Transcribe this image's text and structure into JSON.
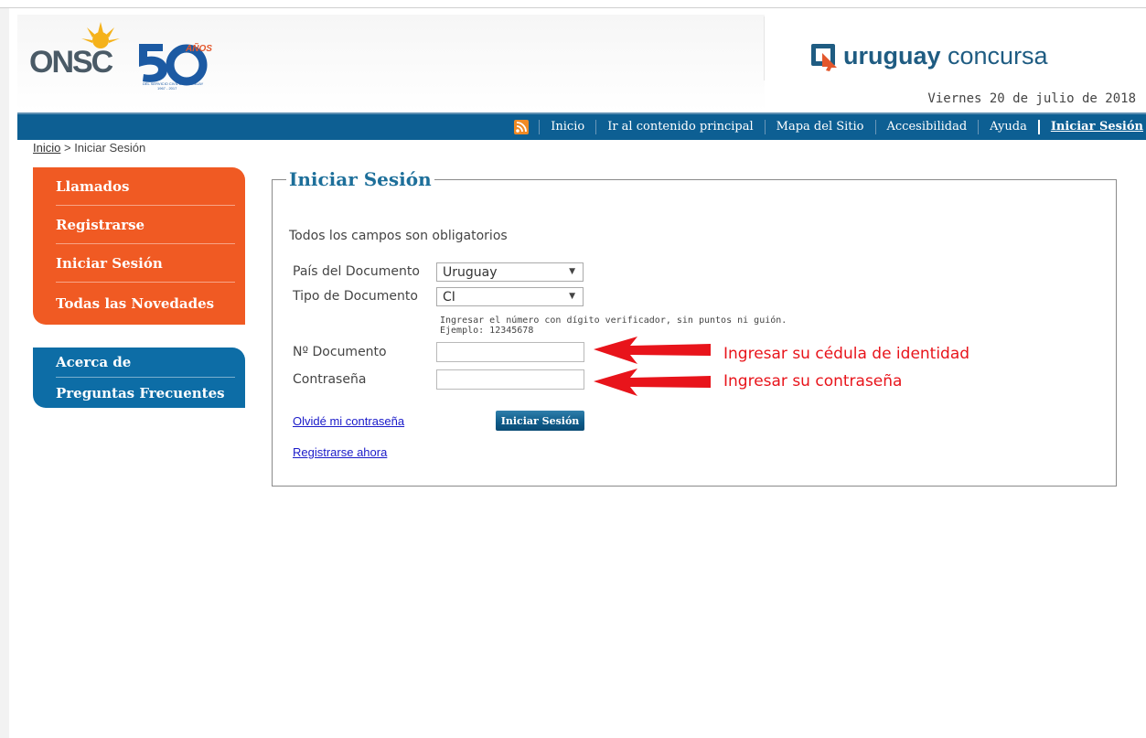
{
  "header": {
    "logo_onsc_text": "ONSC",
    "logo_50_text": "50",
    "logo_anos_text": "AÑOS",
    "logo_tagline": "DEL SERVICIO CIVIL EN URUGUAY",
    "logo_years": "1967 - 2017",
    "concursa_bold": "uruguay",
    "concursa_light": " concursa",
    "date": "Viernes 20 de julio de 2018"
  },
  "nav": {
    "rss_icon": "rss-icon",
    "items": [
      "Inicio",
      "Ir al contenido principal",
      "Mapa del Sitio",
      "Accesibilidad",
      "Ayuda"
    ],
    "login": "Iniciar Sesión"
  },
  "breadcrumb": {
    "home": "Inicio",
    "separator": " > ",
    "current": "Iniciar Sesión"
  },
  "sidebar": {
    "primary": [
      "Llamados",
      "Registrarse",
      "Iniciar Sesión",
      "Todas las Novedades"
    ],
    "secondary": [
      "Acerca de",
      "Preguntas Frecuentes"
    ]
  },
  "form": {
    "legend": "Iniciar Sesión",
    "notice": "Todos los campos son obligatorios",
    "country_label": "País del Documento",
    "country_value": "Uruguay",
    "doctype_label": "Tipo de Documento",
    "doctype_value": "CI",
    "hint_line1": "Ingresar el número con dígito verificador, sin puntos ni guión.",
    "hint_line2": "Ejemplo: 12345678",
    "doc_number_label": "Nº Documento",
    "doc_number_value": "",
    "password_label": "Contraseña",
    "password_value": "",
    "forgot_link": "Olvidé mi contraseña",
    "submit_label": "Iniciar Sesión",
    "register_link": "Registrarse ahora"
  },
  "annotations": {
    "doc_number": "Ingresar su cédula de identidad",
    "password": "Ingresar su contraseña"
  },
  "colors": {
    "nav_blue": "#0d5f93",
    "menu_orange": "#f05a23",
    "menu_blue": "#0d6da6",
    "annotation_red": "#e8141b"
  }
}
